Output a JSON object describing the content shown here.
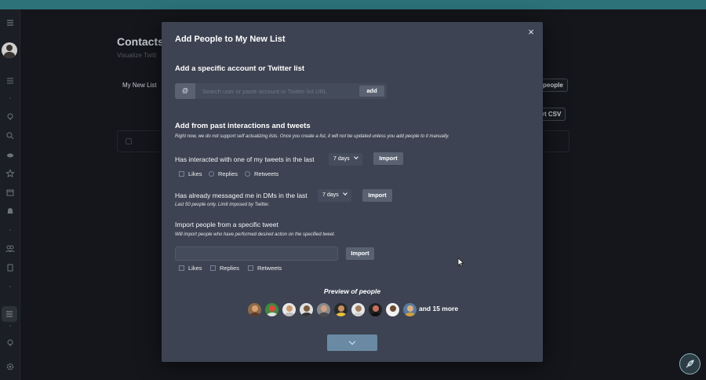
{
  "background": {
    "page_title": "Contacts",
    "page_subtitle": "Visualize Twitt",
    "list_name": "My New List",
    "add_people_button": "people",
    "export_csv_button": "ort CSV"
  },
  "modal": {
    "title": "Add People to My New List",
    "close_icon": "×",
    "section_account": {
      "heading": "Add a specific account or Twitter list",
      "at_symbol": "@",
      "search_placeholder": "Search user or paste account or Twitter list URL",
      "add_label": "add"
    },
    "section_past": {
      "heading": "Add from past interactions and tweets",
      "note": "Right now, we do not support self actualizing lists. Once you create a list, it will not be updated unless you add people to it manually."
    },
    "interacted": {
      "label": "Has interacted with one of my tweets in the last",
      "period": "7 days",
      "import_label": "Import",
      "options": [
        "Likes",
        "Replies",
        "Retweets"
      ]
    },
    "messaged": {
      "label": "Has already messaged me in DMs in the last",
      "period": "7 days",
      "import_label": "Import",
      "note": "Last 50 people only. Limit imposed by Twitter."
    },
    "specific_tweet": {
      "heading": "Import people from a specific tweet",
      "note": "Will import people who have performed desired action on the specified tweet.",
      "import_label": "Import",
      "options": [
        "Likes",
        "Replies",
        "Retweets"
      ]
    },
    "preview": {
      "title": "Preview of people",
      "more_text": "and 15 more"
    }
  },
  "colors": {
    "topbar": "#2c7278",
    "modal_bg": "#3d4352",
    "submit_button": "#6a8aa3"
  }
}
